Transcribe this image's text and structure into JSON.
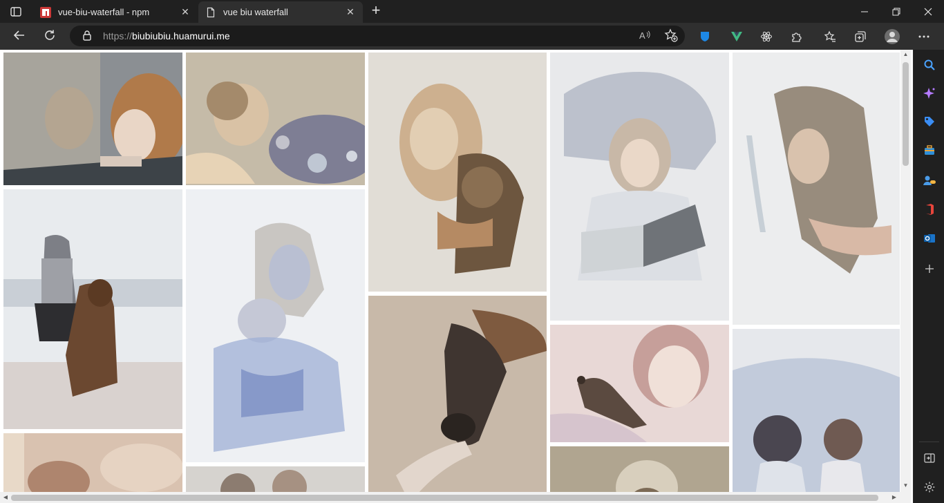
{
  "tabs": [
    {
      "title": "vue-biu-waterfall - npm",
      "favicon": "npm-icon",
      "active": false
    },
    {
      "title": "vue biu waterfall",
      "favicon": "page-icon",
      "active": true
    }
  ],
  "address": {
    "scheme": "https://",
    "host": "biubiubiu.huamurui.me"
  },
  "toolbar": {
    "read_aloud": "A",
    "back": "back-icon",
    "refresh": "refresh-icon"
  },
  "colors": {
    "tab_active_bg": "#2f2f2f",
    "chrome_bg": "#202020",
    "address_bg": "#1b1b1b",
    "page_bg": "#ffffff"
  },
  "gallery": {
    "columns": 5,
    "images": [
      {
        "subject": "girl looking through window"
      },
      {
        "subject": "child blowing bubbles"
      },
      {
        "subject": "woman with puppy"
      },
      {
        "subject": "girl reading book"
      },
      {
        "subject": "woman with long hair"
      },
      {
        "subject": "child with dog at beach"
      },
      {
        "subject": "mother holding baby"
      },
      {
        "subject": "horse and hand"
      },
      {
        "subject": "girl with bird"
      },
      {
        "subject": "two girls"
      },
      {
        "subject": "sepia scene"
      },
      {
        "subject": "figures in blue"
      },
      {
        "subject": "child with cat"
      }
    ]
  }
}
